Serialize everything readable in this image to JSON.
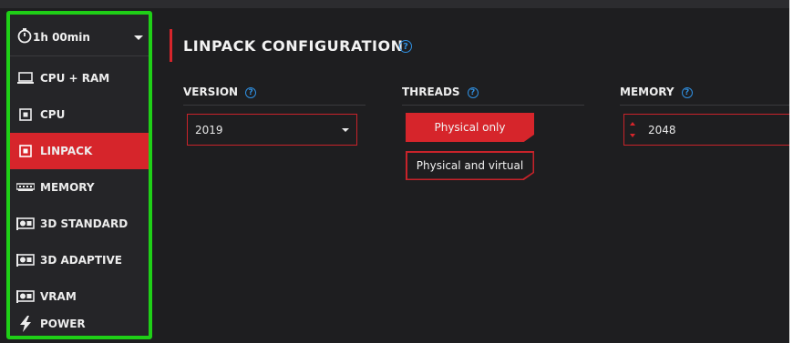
{
  "sidebar": {
    "timer_label": "1h 00min",
    "items": [
      {
        "label": "CPU + RAM",
        "icon": "monitor-icon"
      },
      {
        "label": "CPU",
        "icon": "chip-icon"
      },
      {
        "label": "LINPACK",
        "icon": "chip-icon",
        "active": true
      },
      {
        "label": "MEMORY",
        "icon": "ram-icon"
      },
      {
        "label": "3D STANDARD",
        "icon": "gpu-icon"
      },
      {
        "label": "3D ADAPTIVE",
        "icon": "gpu-icon"
      },
      {
        "label": "VRAM",
        "icon": "gpu-icon"
      },
      {
        "label": "POWER",
        "icon": "lightning-icon"
      }
    ]
  },
  "main": {
    "title": "LINPACK CONFIGURATION",
    "help_glyph": "?",
    "version": {
      "label": "VERSION",
      "value": "2019"
    },
    "threads": {
      "label": "THREADS",
      "options": [
        "Physical only",
        "Physical and virtual"
      ],
      "selected": "Physical only"
    },
    "memory": {
      "label": "MEMORY",
      "value": "2048"
    }
  },
  "colors": {
    "accent": "#d6252b",
    "highlight_border": "#1fcf17",
    "help": "#2f8fe0",
    "background": "#1e1e20"
  }
}
